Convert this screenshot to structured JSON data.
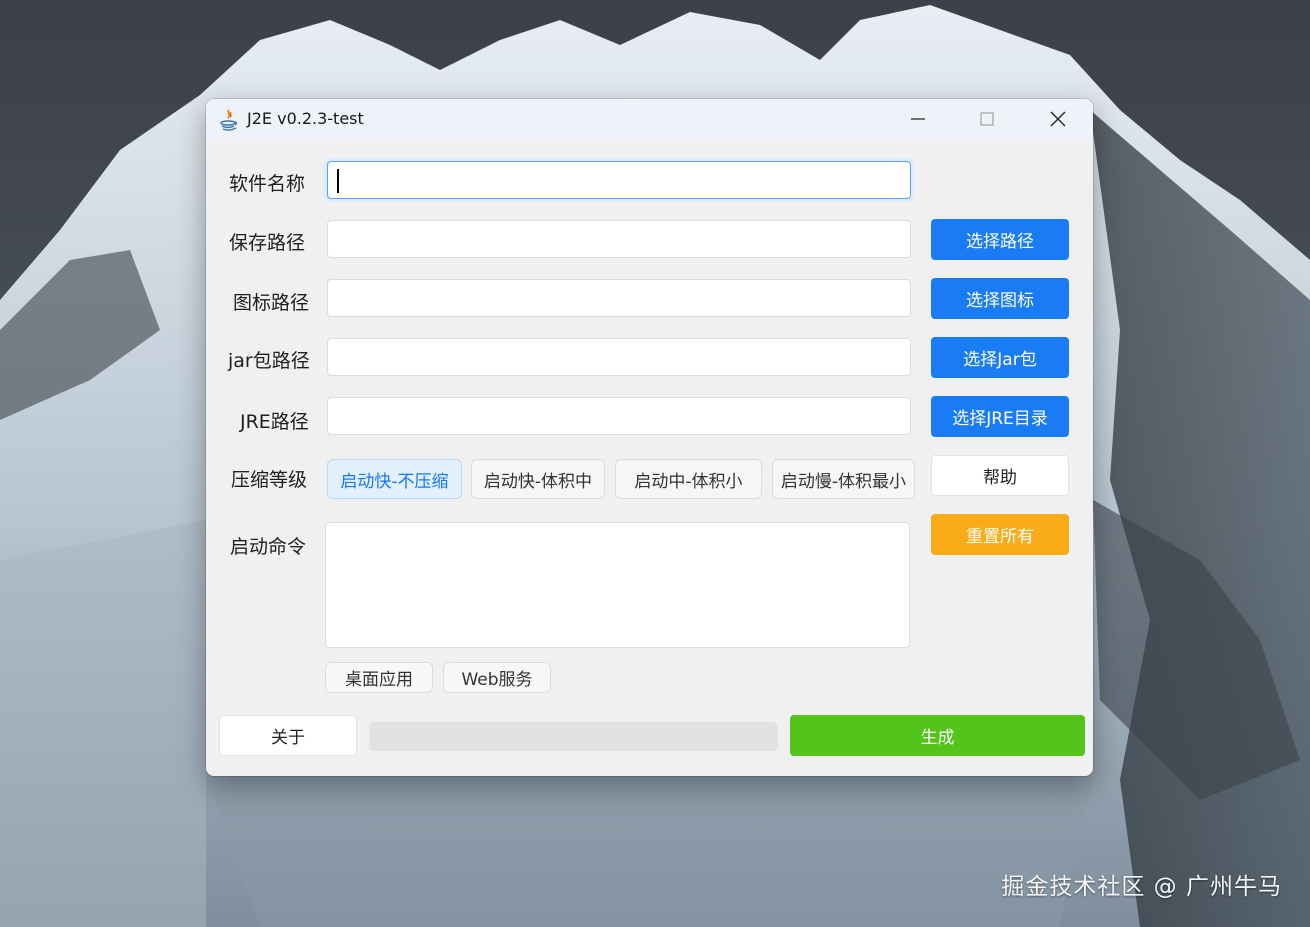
{
  "window": {
    "title": "J2E v0.2.3-test",
    "icon": "java-icon"
  },
  "form": {
    "software_name": {
      "label": "软件名称",
      "value": ""
    },
    "save_path": {
      "label": "保存路径",
      "value": ""
    },
    "icon_path": {
      "label": "图标路径",
      "value": ""
    },
    "jar_path": {
      "label": "jar包路径",
      "value": ""
    },
    "jre_path": {
      "label": "JRE路径",
      "value": ""
    },
    "compression": {
      "label": "压缩等级",
      "options": [
        "启动快-不压缩",
        "启动快-体积中",
        "启动中-体积小",
        "启动慢-体积最小"
      ],
      "selected": "启动快-不压缩"
    },
    "startup_command": {
      "label": "启动命令",
      "value": ""
    },
    "presets": [
      "桌面应用",
      "Web服务"
    ]
  },
  "buttons": {
    "choose_path": "选择路径",
    "choose_icon": "选择图标",
    "choose_jar": "选择Jar包",
    "choose_jre": "选择JRE目录",
    "help": "帮助",
    "reset_all": "重置所有",
    "about": "关于",
    "generate": "生成"
  },
  "progress": {
    "value": 0
  },
  "colors": {
    "primary": "#1a7cf5",
    "warning": "#f9ac18",
    "success": "#52c41a",
    "selected_bg": "#e3f0fd"
  },
  "watermark": "掘金技术社区 @ 广州牛马"
}
